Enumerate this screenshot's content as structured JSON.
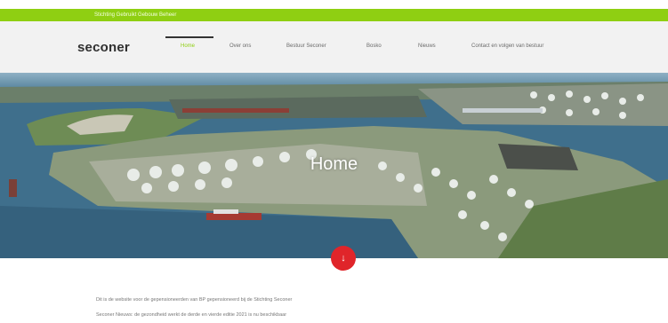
{
  "topbar": {
    "text": "Stichting Gebruikt Gebouw Beheer"
  },
  "header": {
    "logo": "seconer",
    "nav": [
      {
        "label": "Home",
        "active": true
      },
      {
        "label": "Over ons",
        "active": false
      },
      {
        "label": "Bestuur Seconer",
        "active": false
      },
      {
        "label": "Bosko",
        "active": false
      },
      {
        "label": "Nieuws",
        "active": false
      },
      {
        "label": "Contact en volgen van bestuur",
        "active": false
      }
    ]
  },
  "hero": {
    "title": "Home",
    "image_description_icon": "aerial-port-refinery-photo"
  },
  "scroll_button": {
    "icon": "arrow-down-icon",
    "glyph": "↓"
  },
  "content": {
    "lines": [
      "Dit is de website voor de gepensioneerden van BP gepensioneerd bij de Stichting Seconer",
      "Seconer Nieuws: de gezondheid werkt de derde en vierde editie 2021 is nu beschikbaar"
    ]
  },
  "colors": {
    "accent": "#8fcf12",
    "button": "#e0252a",
    "nav_bg": "#f2f2f2"
  }
}
